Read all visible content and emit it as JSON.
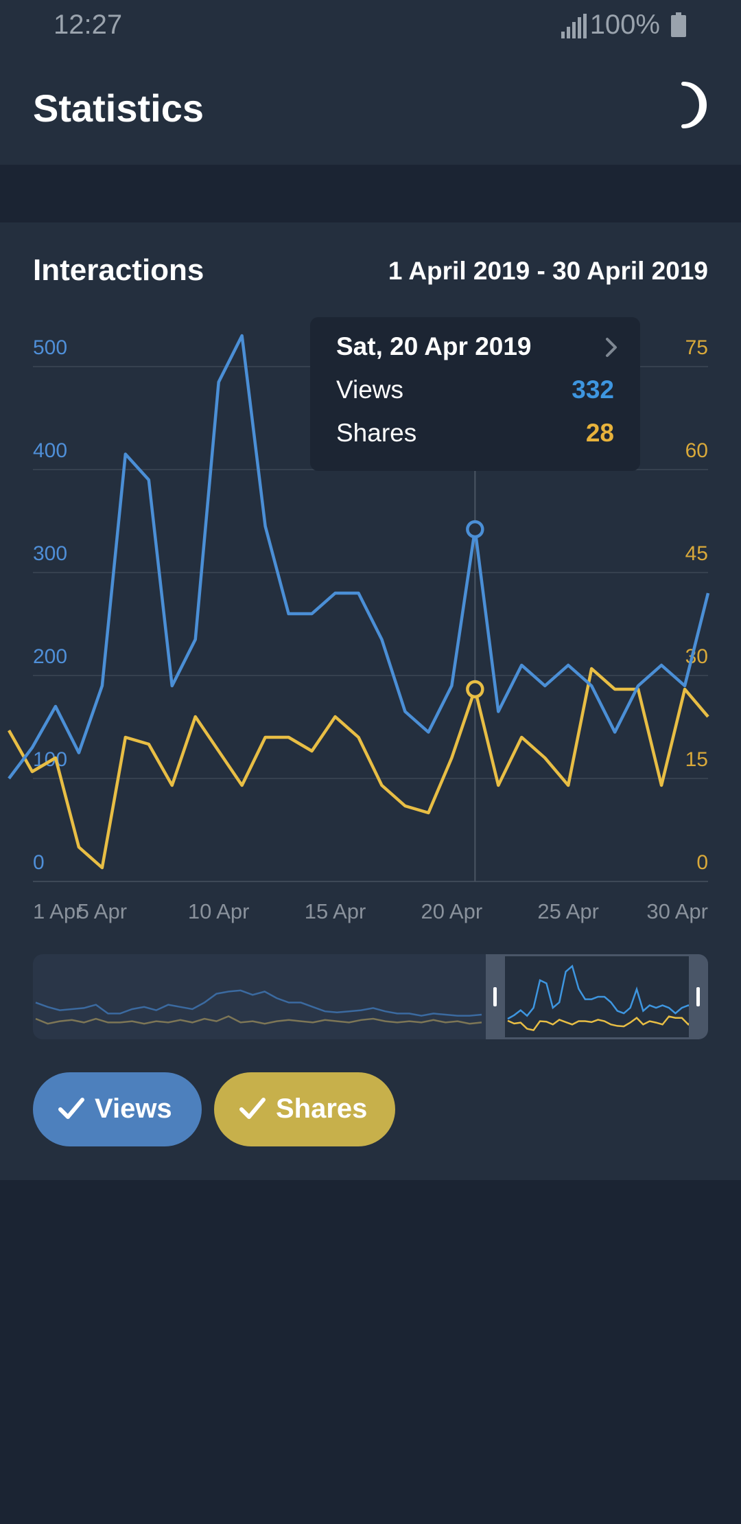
{
  "status": {
    "time": "12:27",
    "battery": "100%"
  },
  "app": {
    "title": "Statistics",
    "theme_icon": "moon-icon"
  },
  "card": {
    "title": "Interactions",
    "range": "1 April 2019 - 30 April 2019"
  },
  "tooltip": {
    "date": "Sat, 20 Apr 2019",
    "rows": [
      {
        "label": "Views",
        "value": "332",
        "color": "#3e96e0"
      },
      {
        "label": "Shares",
        "value": "28",
        "color": "#e8b33c"
      }
    ]
  },
  "chips": [
    {
      "label": "Views",
      "color": "#4d80bd",
      "checked": true
    },
    {
      "label": "Shares",
      "color": "#c7b04b",
      "checked": true
    }
  ],
  "colors": {
    "views": "#4b8fd6",
    "shares": "#e8be45",
    "grid": "#36414f",
    "axis_text": "#8a929c"
  },
  "chart_data": {
    "type": "line",
    "title": "Interactions",
    "x": [
      0,
      1,
      2,
      3,
      4,
      5,
      6,
      7,
      8,
      9,
      10,
      11,
      12,
      13,
      14,
      15,
      16,
      17,
      18,
      19,
      20,
      21,
      22,
      23,
      24,
      25,
      26,
      27,
      28,
      29,
      30
    ],
    "x_tick_labels": [
      "1 Apr",
      "5 Apr",
      "10 Apr",
      "15 Apr",
      "20 Apr",
      "25 Apr",
      "30 Apr"
    ],
    "left_axis": {
      "ticks": [
        0,
        100,
        200,
        300,
        400,
        500
      ],
      "ylim": [
        0,
        500
      ]
    },
    "right_axis": {
      "ticks": [
        0,
        15,
        30,
        45,
        60,
        75
      ],
      "ylim": [
        0,
        75
      ]
    },
    "series": [
      {
        "name": "Views",
        "axis": "left",
        "values": [
          100,
          130,
          170,
          125,
          190,
          415,
          390,
          190,
          235,
          485,
          530,
          345,
          260,
          260,
          280,
          280,
          235,
          165,
          145,
          190,
          342,
          165,
          210,
          190,
          210,
          190,
          145,
          190,
          210,
          190,
          280
        ]
      },
      {
        "name": "Shares",
        "axis": "right",
        "values": [
          22,
          16,
          18,
          5,
          2,
          21,
          20,
          14,
          24,
          19,
          14,
          21,
          21,
          19,
          24,
          21,
          14,
          11,
          10,
          18,
          28,
          14,
          21,
          18,
          14,
          31,
          28,
          28,
          14,
          28,
          24
        ]
      }
    ],
    "highlight_index": 20,
    "legend": "toggle chips below chart"
  }
}
